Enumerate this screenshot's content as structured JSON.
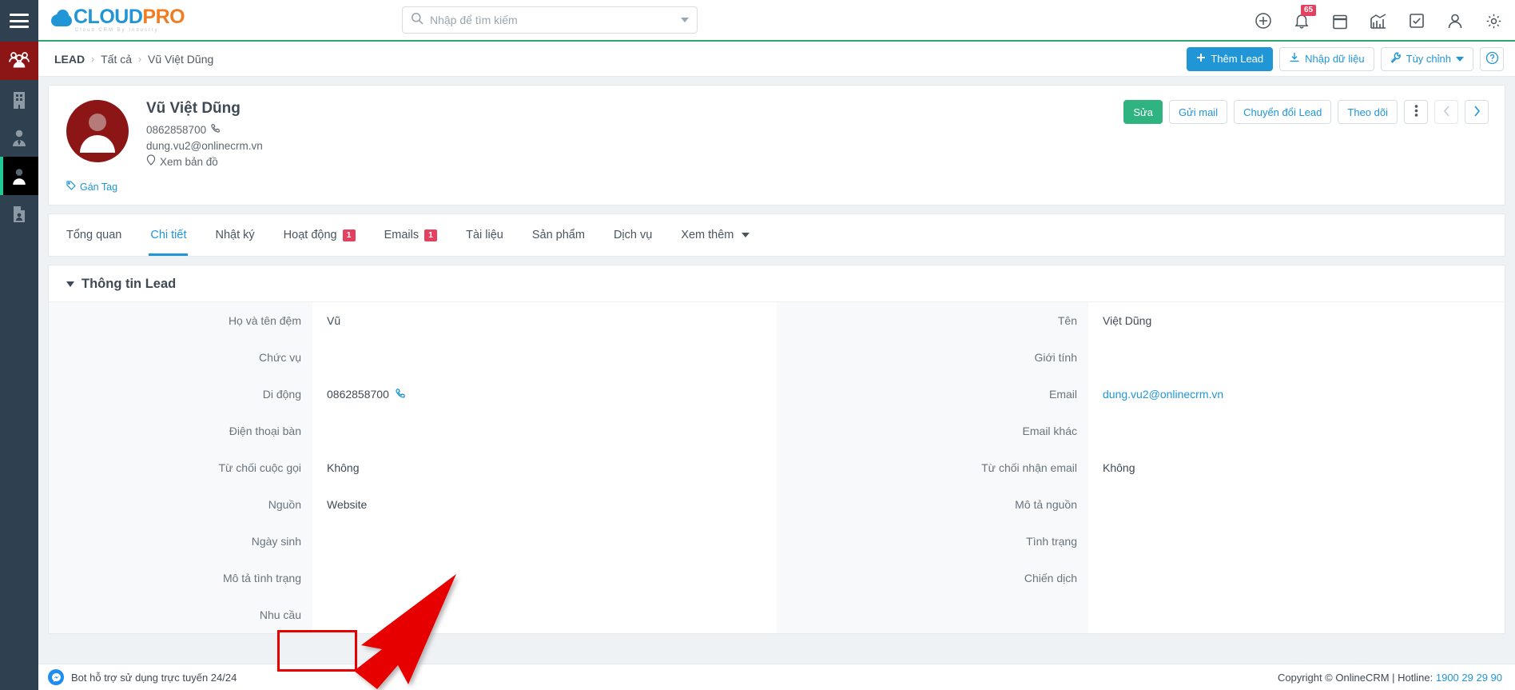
{
  "brand": {
    "name_part1": "CLOUD",
    "name_part2": "PRO",
    "tagline": "Cloud CRM By Industry"
  },
  "search": {
    "placeholder": "Nhập để tìm kiếm",
    "value": ""
  },
  "topbar": {
    "icons": [
      {
        "name": "add-circle-icon",
        "label": "Thêm mới"
      },
      {
        "name": "bell-icon",
        "label": "Thông báo",
        "badge": "65"
      },
      {
        "name": "calendar-icon",
        "label": "Lịch"
      },
      {
        "name": "chart-icon",
        "label": "Báo cáo"
      },
      {
        "name": "task-check-icon",
        "label": "Công việc"
      },
      {
        "name": "user-icon",
        "label": "Tài khoản"
      },
      {
        "name": "gear-icon",
        "label": "Cài đặt"
      }
    ]
  },
  "sidebar": {
    "items": [
      {
        "name": "sidebar-item-leads",
        "icon": "group-people-icon",
        "state": "active-red"
      },
      {
        "name": "sidebar-item-company",
        "icon": "building-icon",
        "state": ""
      },
      {
        "name": "sidebar-item-contact",
        "icon": "person-tie-icon",
        "state": ""
      },
      {
        "name": "sidebar-item-person",
        "icon": "person-icon",
        "state": "active-dark"
      },
      {
        "name": "sidebar-item-document",
        "icon": "document-person-icon",
        "state": ""
      }
    ]
  },
  "breadcrumb": {
    "root": "LEAD",
    "sep": "›",
    "items": [
      "Tất cả",
      "Vũ Việt Dũng"
    ]
  },
  "crumb_actions": {
    "add_lead": "Thêm Lead",
    "import": "Nhập dữ liệu",
    "customize": "Tùy chỉnh",
    "help": "?"
  },
  "profile": {
    "name": "Vũ Việt Dũng",
    "phone": "0862858700",
    "email": "dung.vu2@onlinecrm.vn",
    "map_link": "Xem bản đồ",
    "tag_link": "Gán Tag",
    "actions": {
      "edit": "Sửa",
      "send_mail": "Gửi mail",
      "convert": "Chuyển đổi Lead",
      "follow": "Theo dõi"
    }
  },
  "tabs": [
    {
      "label": "Tổng quan",
      "active": false,
      "count": ""
    },
    {
      "label": "Chi tiết",
      "active": true,
      "count": ""
    },
    {
      "label": "Nhật ký",
      "active": false,
      "count": ""
    },
    {
      "label": "Hoạt động",
      "active": false,
      "count": "1"
    },
    {
      "label": "Emails",
      "active": false,
      "count": "1"
    },
    {
      "label": "Tài liệu",
      "active": false,
      "count": ""
    },
    {
      "label": "Sản phẩm",
      "active": false,
      "count": ""
    },
    {
      "label": "Dịch vụ",
      "active": false,
      "count": ""
    },
    {
      "label": "Xem thêm",
      "active": false,
      "count": "",
      "dropdown": true
    }
  ],
  "section": {
    "title": "Thông tin Lead",
    "left_fields": [
      {
        "label": "Họ và tên đệm",
        "value": "Vũ",
        "type": "text"
      },
      {
        "label": "Chức vụ",
        "value": "",
        "type": "text"
      },
      {
        "label": "Di động",
        "value": "0862858700",
        "type": "phone"
      },
      {
        "label": "Điện thoại bàn",
        "value": "",
        "type": "text"
      },
      {
        "label": "Từ chối cuộc gọi",
        "value": "Không",
        "type": "text"
      },
      {
        "label": "Nguồn",
        "value": "Website",
        "type": "text"
      },
      {
        "label": "Ngày sinh",
        "value": "",
        "type": "text"
      },
      {
        "label": "Mô tả tình trạng",
        "value": "",
        "type": "text"
      },
      {
        "label": "Nhu cầu",
        "value": "",
        "type": "text",
        "highlight": true
      }
    ],
    "right_fields": [
      {
        "label": "Tên",
        "value": "Việt Dũng",
        "type": "text"
      },
      {
        "label": "Giới tính",
        "value": "",
        "type": "text"
      },
      {
        "label": "Email",
        "value": "dung.vu2@onlinecrm.vn",
        "type": "link"
      },
      {
        "label": "Email khác",
        "value": "",
        "type": "text"
      },
      {
        "label": "Từ chối nhận email",
        "value": "Không",
        "type": "text"
      },
      {
        "label": "Mô tả nguồn",
        "value": "",
        "type": "text"
      },
      {
        "label": "Tình trạng",
        "value": "",
        "type": "text"
      },
      {
        "label": "Chiến dịch",
        "value": "",
        "type": "text"
      },
      {
        "label": "",
        "value": "",
        "type": "text"
      }
    ]
  },
  "footer": {
    "bot_text": "Bot hỗ trợ sử dụng trực tuyến 24/24",
    "copyright": "Copyright © OnlineCRM | Hotline: ",
    "hotline": "1900 29 29 90"
  },
  "colors": {
    "brand_blue": "#2196d6",
    "brand_orange": "#f07d22",
    "accent_green": "#2aa96b",
    "edit_green": "#2fb380",
    "badge_red": "#e4405f",
    "avatar_red": "#8c1515",
    "rail_dark": "#2f4050",
    "annotation_red": "#e60000"
  }
}
